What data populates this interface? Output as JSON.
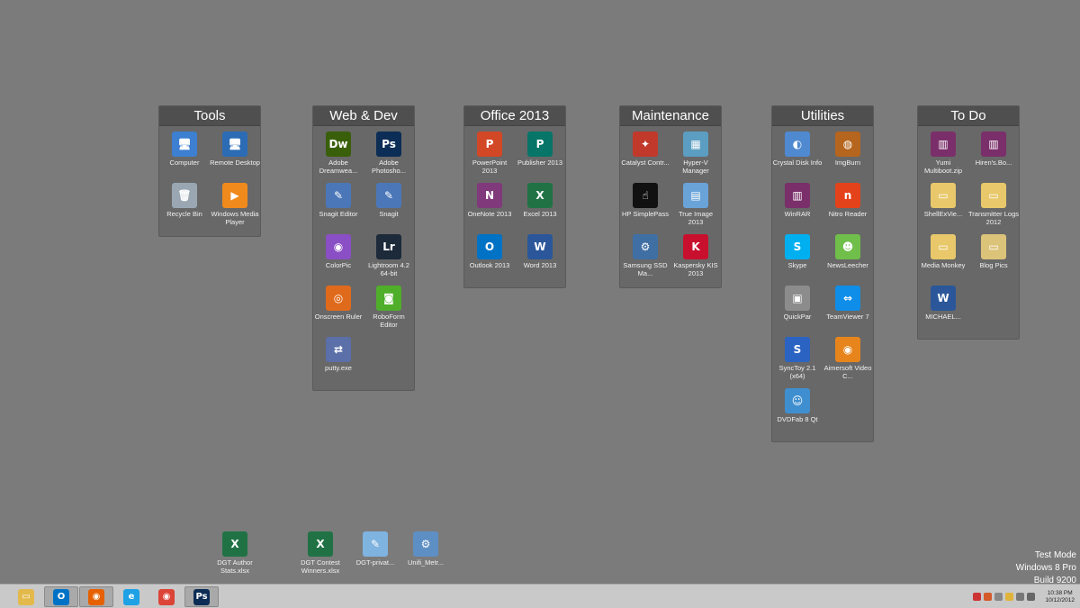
{
  "fences": [
    {
      "title": "Tools",
      "items": [
        {
          "label": "Computer",
          "icon": "computer-icon",
          "color": "#3d7fd0",
          "glyph": "🖥"
        },
        {
          "label": "Remote Desktop",
          "icon": "remote-desktop-icon",
          "color": "#2c6cb5",
          "glyph": "🖥"
        },
        {
          "label": "Recycle Bin",
          "icon": "recycle-bin-icon",
          "color": "#9aa7b3",
          "glyph": "🗑"
        },
        {
          "label": "Windows Media Player",
          "icon": "media-player-icon",
          "color": "#f08a1c",
          "glyph": "▶"
        }
      ]
    },
    {
      "title": "Web & Dev",
      "items": [
        {
          "label": "Adobe Dreamwea...",
          "icon": "dreamweaver-icon",
          "color": "#3a5f0b",
          "glyph": "Dw"
        },
        {
          "label": "Adobe Photosho...",
          "icon": "photoshop-icon",
          "color": "#0c2d55",
          "glyph": "Ps"
        },
        {
          "label": "Snagit Editor",
          "icon": "snagit-editor-icon",
          "color": "#4b77b8",
          "glyph": "✎"
        },
        {
          "label": "Snagit",
          "icon": "snagit-icon",
          "color": "#4b77b8",
          "glyph": "✎"
        },
        {
          "label": "ColorPic",
          "icon": "colorpic-icon",
          "color": "#8a4fc4",
          "glyph": "◉"
        },
        {
          "label": "Lightroom 4.2 64-bit",
          "icon": "lightroom-icon",
          "color": "#1c2a3a",
          "glyph": "Lr"
        },
        {
          "label": "Onscreen Ruler",
          "icon": "onscreen-ruler-icon",
          "color": "#e06a1b",
          "glyph": "◎"
        },
        {
          "label": "RoboForm Editor",
          "icon": "roboform-icon",
          "color": "#4fae2a",
          "glyph": "◙"
        },
        {
          "label": "putty.exe",
          "icon": "putty-icon",
          "color": "#5b6fa8",
          "glyph": "⇄"
        }
      ]
    },
    {
      "title": "Office 2013",
      "items": [
        {
          "label": "PowerPoint 2013",
          "icon": "powerpoint-icon",
          "color": "#d24726",
          "glyph": "P"
        },
        {
          "label": "Publisher 2013",
          "icon": "publisher-icon",
          "color": "#077568",
          "glyph": "P"
        },
        {
          "label": "OneNote 2013",
          "icon": "onenote-icon",
          "color": "#80397b",
          "glyph": "N"
        },
        {
          "label": "Excel 2013",
          "icon": "excel-icon",
          "color": "#207245",
          "glyph": "X"
        },
        {
          "label": "Outlook 2013",
          "icon": "outlook-icon",
          "color": "#0072c6",
          "glyph": "O"
        },
        {
          "label": "Word 2013",
          "icon": "word-icon",
          "color": "#2b579a",
          "glyph": "W"
        }
      ]
    },
    {
      "title": "Maintenance",
      "items": [
        {
          "label": "Catalyst Contr...",
          "icon": "catalyst-icon",
          "color": "#c0392b",
          "glyph": "✦"
        },
        {
          "label": "Hyper-V Manager",
          "icon": "hyper-v-icon",
          "color": "#5c9ec2",
          "glyph": "▦"
        },
        {
          "label": "HP SimplePass",
          "icon": "hp-simplepass-icon",
          "color": "#111111",
          "glyph": "☝"
        },
        {
          "label": "True Image 2013",
          "icon": "true-image-icon",
          "color": "#6aa3d8",
          "glyph": "▤"
        },
        {
          "label": "Samsung SSD Ma...",
          "icon": "samsung-ssd-icon",
          "color": "#3f6fa3",
          "glyph": "⚙"
        },
        {
          "label": "Kaspersky KIS 2013",
          "icon": "kaspersky-icon",
          "color": "#c8102e",
          "glyph": "K"
        }
      ]
    },
    {
      "title": "Utilities",
      "items": [
        {
          "label": "Crystal Disk Info",
          "icon": "crystal-disk-icon",
          "color": "#4f8ad1",
          "glyph": "◐"
        },
        {
          "label": "ImgBurn",
          "icon": "imgburn-icon",
          "color": "#b5651d",
          "glyph": "◍"
        },
        {
          "label": "WinRAR",
          "icon": "winrar-icon",
          "color": "#7a2f6a",
          "glyph": "▥"
        },
        {
          "label": "Nitro Reader",
          "icon": "nitro-icon",
          "color": "#e4421a",
          "glyph": "n"
        },
        {
          "label": "Skype",
          "icon": "skype-icon",
          "color": "#00aff0",
          "glyph": "S"
        },
        {
          "label": "NewsLeecher",
          "icon": "newsleecher-icon",
          "color": "#6fbf4a",
          "glyph": "☻"
        },
        {
          "label": "QuickPar",
          "icon": "quickpar-icon",
          "color": "#8c8c8c",
          "glyph": "▣"
        },
        {
          "label": "TeamViewer 7",
          "icon": "teamviewer-icon",
          "color": "#0e8ee9",
          "glyph": "⇔"
        },
        {
          "label": "SyncToy 2.1 (x64)",
          "icon": "synctoy-icon",
          "color": "#2b63c2",
          "glyph": "S"
        },
        {
          "label": "Aimersoft Video C...",
          "icon": "aimersoft-icon",
          "color": "#e7851c",
          "glyph": "◉"
        },
        {
          "label": "DVDFab 8 Qt",
          "icon": "dvdfab-icon",
          "color": "#3f8fd0",
          "glyph": "☺"
        }
      ]
    },
    {
      "title": "To Do",
      "items": [
        {
          "label": "Yumi Multiboot.zip",
          "icon": "archive-icon",
          "color": "#7a2f6a",
          "glyph": "▥"
        },
        {
          "label": "Hiren's.Bo...",
          "icon": "archive-icon",
          "color": "#7a2f6a",
          "glyph": "▥"
        },
        {
          "label": "ShellExVie...",
          "icon": "folder-icon",
          "color": "#e8c86a",
          "glyph": "▭"
        },
        {
          "label": "Transmitter Logs 2012",
          "icon": "folder-icon",
          "color": "#e8c86a",
          "glyph": "▭"
        },
        {
          "label": "Media Monkey",
          "icon": "folder-icon",
          "color": "#e8c86a",
          "glyph": "▭"
        },
        {
          "label": "Blog Pics",
          "icon": "folder-pictures-icon",
          "color": "#dcc37a",
          "glyph": "▭"
        },
        {
          "label": "MICHAEL...",
          "icon": "word-document-icon",
          "color": "#2b579a",
          "glyph": "W"
        }
      ]
    }
  ],
  "desktop_files": [
    {
      "label": "DGT Author Stats.xlsx",
      "icon": "excel-file-icon",
      "color": "#207245",
      "glyph": "X"
    },
    {
      "label": "DGT Contest Winners.xlsx",
      "icon": "excel-file-icon",
      "color": "#207245",
      "glyph": "X"
    },
    {
      "label": "DGT-privat...",
      "icon": "notepad-file-icon",
      "color": "#7fb3e0",
      "glyph": "✎"
    },
    {
      "label": "Unifi_Metr...",
      "icon": "settings-file-icon",
      "color": "#5d8fc4",
      "glyph": "⚙"
    }
  ],
  "watermark": {
    "line1": "Test Mode",
    "line2": "Windows 8 Pro",
    "line3": "Build 9200"
  },
  "taskbar": {
    "apps": [
      {
        "name": "File Explorer",
        "icon": "file-explorer-icon",
        "color": "#e2b94a",
        "glyph": "▭",
        "active": false
      },
      {
        "name": "Outlook",
        "icon": "outlook-icon",
        "color": "#0072c6",
        "glyph": "O",
        "active": true
      },
      {
        "name": "Firefox",
        "icon": "firefox-icon",
        "color": "#e66000",
        "glyph": "◉",
        "active": true
      },
      {
        "name": "Internet Explorer",
        "icon": "internet-explorer-icon",
        "color": "#1ea1e5",
        "glyph": "e",
        "active": false
      },
      {
        "name": "Chrome",
        "icon": "chrome-icon",
        "color": "#db4437",
        "glyph": "◉",
        "active": false
      },
      {
        "name": "Photoshop",
        "icon": "photoshop-icon",
        "color": "#0c2d55",
        "glyph": "Ps",
        "active": true
      }
    ],
    "clock_time": "10:38 PM",
    "clock_date": "10/12/2012"
  }
}
